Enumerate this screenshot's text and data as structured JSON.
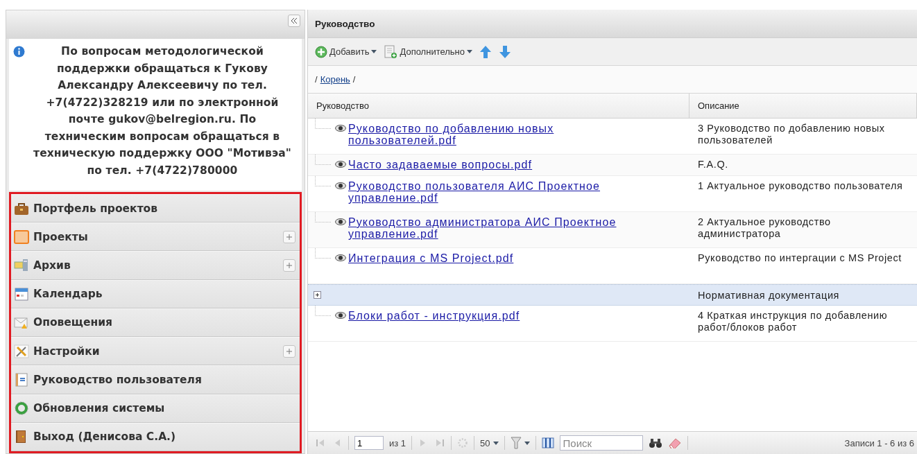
{
  "sidebar": {
    "info": "По вопросам методологической поддержки обращаться к Гукову Александру Алексеевичу по тел. +7(4722)328219 или по электронной почте gukov@belregion.ru. По техническим вопросам обращаться в техническую поддержку ООО \"Мотивэа\" по тел. +7(4722)780000",
    "items": [
      {
        "label": "Портфель проектов",
        "expandable": false
      },
      {
        "label": "Проекты",
        "expandable": true
      },
      {
        "label": "Архив",
        "expandable": true
      },
      {
        "label": "Календарь",
        "expandable": false
      },
      {
        "label": "Оповещения",
        "expandable": false
      },
      {
        "label": "Настройки",
        "expandable": true
      },
      {
        "label": "Руководство пользователя",
        "expandable": false
      },
      {
        "label": "Обновления системы",
        "expandable": false
      },
      {
        "label": "Выход (Денисова С.А.)",
        "expandable": false
      }
    ]
  },
  "panel": {
    "title": "Руководство",
    "toolbar": [
      {
        "label": "Добавить"
      },
      {
        "label": "Дополнительно"
      }
    ],
    "breadcrumb": {
      "prefix": "/",
      "link": "Корень",
      "suffix": "/"
    },
    "table": {
      "columns": [
        "Руководство",
        "Описание"
      ],
      "rows": [
        {
          "kind": "file",
          "name": "Руководство по добавлению новых пользователей.pdf",
          "description": "3 Руководство по добавлению новых пользователей"
        },
        {
          "kind": "file",
          "name": "Часто задаваемые вопросы.pdf",
          "description": "F.A.Q."
        },
        {
          "kind": "file",
          "name": "Руководство пользователя АИС Проектное управление.pdf",
          "description": "1 Актуальное руководство пользователя"
        },
        {
          "kind": "file",
          "name": "Руководство администратора АИС Проектное управление.pdf",
          "description": "2 Актуальное руководство администратора"
        },
        {
          "kind": "file",
          "name": "Интеграция с MS Project.pdf",
          "description": "Руководство по интергации с MS Project"
        },
        {
          "kind": "group",
          "expanded": false,
          "description": "Нормативная документация"
        },
        {
          "kind": "file",
          "name": "Блоки работ - инструкция.pdf",
          "description": "4 Краткая инструкция по добавлению работ/блоков работ"
        }
      ]
    },
    "pager": {
      "page": "1",
      "of": "из 1",
      "page_size": "50",
      "search": {
        "placeholder": "Поиск"
      },
      "records": "Записи 1 - 6 из 6"
    }
  }
}
